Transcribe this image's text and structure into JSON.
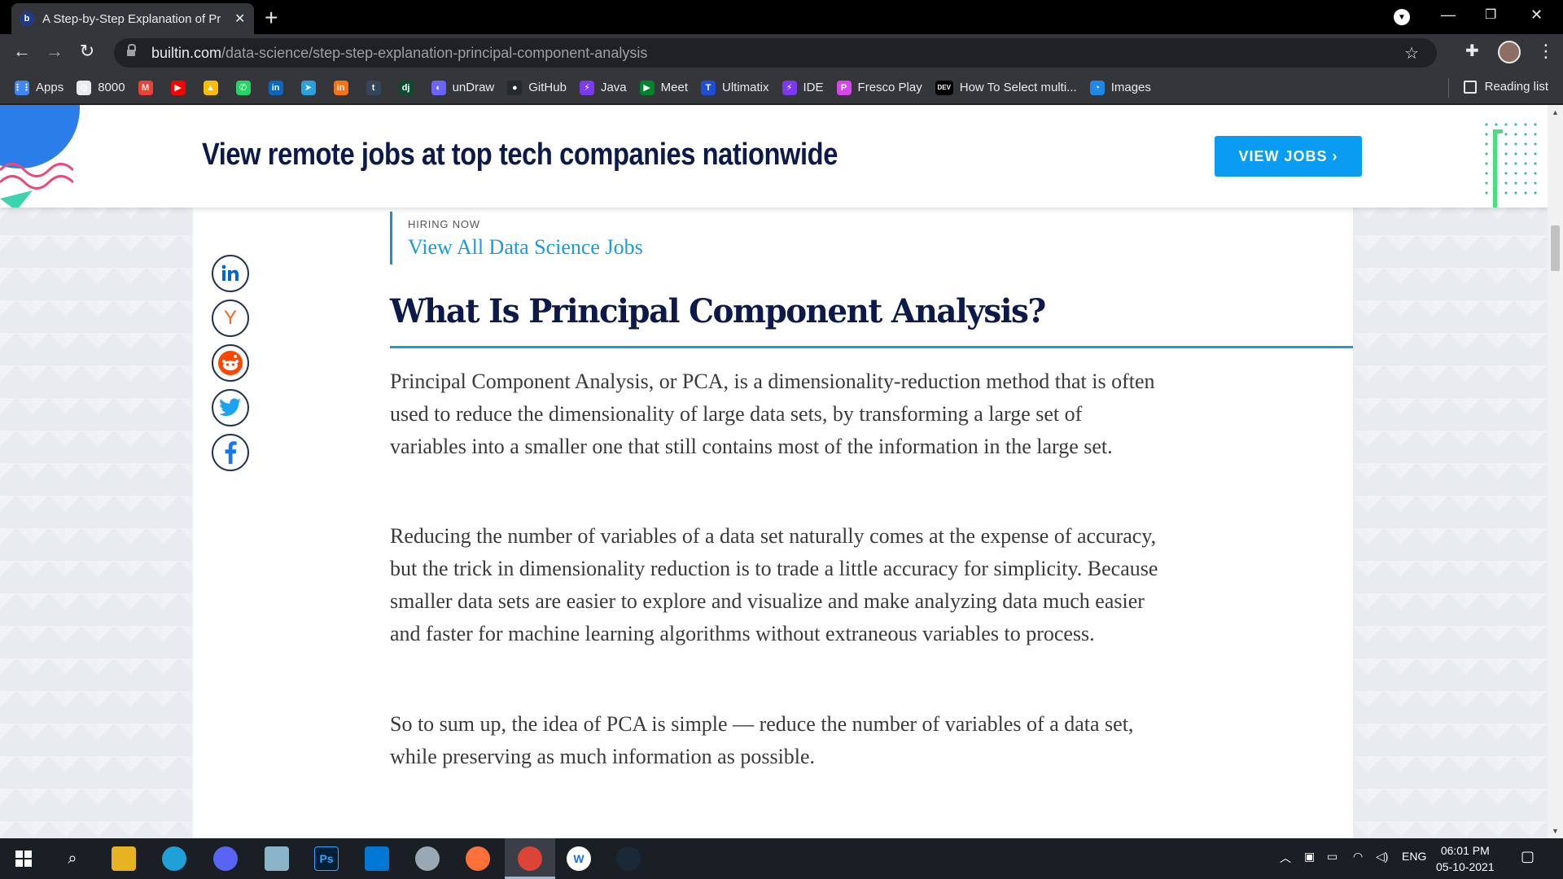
{
  "browser": {
    "tab_title": "A Step-by-Step Explanation of Pr",
    "tab_favicon": "b",
    "url_host": "builtin.com",
    "url_path": "/data-science/step-step-explanation-principal-component-analysis"
  },
  "bookmarks": [
    {
      "label": "Apps",
      "icon": "apps-grid-icon",
      "color": "#4285f4"
    },
    {
      "label": "8000",
      "icon": "globe-icon",
      "color": "#e8eaed"
    },
    {
      "label": "",
      "icon": "gmail-icon",
      "color": "#ea4335"
    },
    {
      "label": "",
      "icon": "youtube-icon",
      "color": "#ff0000"
    },
    {
      "label": "",
      "icon": "drive-icon",
      "color": "#fbbc04"
    },
    {
      "label": "",
      "icon": "whatsapp-icon",
      "color": "#25d366"
    },
    {
      "label": "",
      "icon": "linkedin-icon",
      "color": "#0a66c2"
    },
    {
      "label": "",
      "icon": "telegram-icon",
      "color": "#2aa1da"
    },
    {
      "label": "",
      "icon": "in-icon",
      "color": "#f97316"
    },
    {
      "label": "",
      "icon": "tumblr-icon",
      "color": "#35465c"
    },
    {
      "label": "",
      "icon": "dj-icon",
      "color": "#0c4b33"
    },
    {
      "label": "unDraw",
      "icon": "undraw-icon",
      "color": "#6c63ff"
    },
    {
      "label": "GitHub",
      "icon": "github-icon",
      "color": "#24292e"
    },
    {
      "label": "Java",
      "icon": "bolt-icon",
      "color": "#7c3aed"
    },
    {
      "label": "Meet",
      "icon": "meet-icon",
      "color": "#00832d"
    },
    {
      "label": "Ultimatix",
      "icon": "tata-icon",
      "color": "#1d4ed8"
    },
    {
      "label": "IDE",
      "icon": "bolt-icon",
      "color": "#7c3aed"
    },
    {
      "label": "Fresco Play",
      "icon": "fresco-icon",
      "color": "#d946ef"
    },
    {
      "label": "How To Select multi...",
      "icon": "dev-icon",
      "color": "#000000"
    },
    {
      "label": "Images",
      "icon": "images-icon",
      "color": "#1e88e5"
    }
  ],
  "reading_list": "Reading list",
  "banner": {
    "headline": "View remote jobs at top tech companies nationwide",
    "button": "VIEW JOBS ›"
  },
  "article": {
    "hiring_label": "HIRING NOW",
    "hiring_link": "View All Data Science Jobs",
    "heading": "What Is Principal Component Analysis?",
    "paragraphs": [
      "Principal Component Analysis, or PCA, is a dimensionality-reduction method that is often used to reduce the dimensionality of large data sets, by transforming a large set of variables into a smaller one that still contains most of the information in the large set.",
      "Reducing the number of variables of a data set naturally comes at the expense of accuracy, but the trick in dimensionality reduction is to trade a little accuracy for simplicity. Because smaller data sets are easier to explore and visualize and make analyzing data much easier and faster for machine learning algorithms without extraneous variables to process.",
      "So to sum up, the idea of PCA is simple — reduce the number of variables of a data set, while preserving as much information as possible."
    ]
  },
  "share_icons": [
    "linkedin-icon",
    "hacker-news-icon",
    "reddit-icon",
    "twitter-icon",
    "facebook-icon"
  ],
  "taskbar": {
    "language": "ENG",
    "time": "06:01 PM",
    "date": "05-10-2021"
  }
}
